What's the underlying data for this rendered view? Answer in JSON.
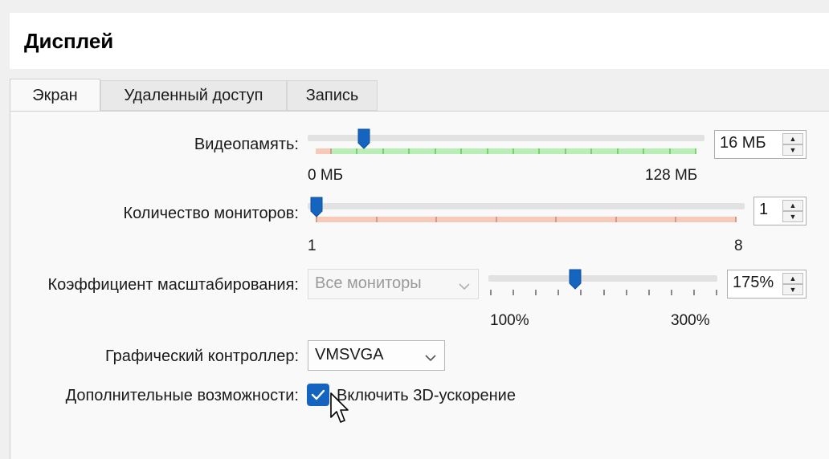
{
  "header": {
    "title": "Дисплей"
  },
  "tabs": [
    {
      "label": "Экран",
      "active": true
    },
    {
      "label": "Удаленный доступ",
      "active": false
    },
    {
      "label": "Запись",
      "active": false
    }
  ],
  "video_memory": {
    "label": "Видеопамять:",
    "value": "16 МБ",
    "min_label": "0 МБ",
    "max_label": "128 МБ",
    "fraction": 0.125
  },
  "monitors": {
    "label": "Количество мониторов:",
    "value": "1",
    "min_label": "1",
    "max_label": "8",
    "fraction": 0.0
  },
  "scale": {
    "label": "Коэффициент масштабирования:",
    "monitor_select": "Все мониторы",
    "value": "175%",
    "min_label": "100%",
    "max_label": "300%",
    "fraction": 0.375
  },
  "graphics_controller": {
    "label": "Графический контроллер:",
    "value": "VMSVGA"
  },
  "extended_features": {
    "label": "Дополнительные возможности:",
    "checkbox_label": "Включить 3D-ускорение",
    "checked": true
  },
  "colors": {
    "accent": "#1565c0",
    "good_bar": "#b9efb6",
    "good_tick": "#7ccf74",
    "warn_bar": "#f6c9b9",
    "warn_tick": "#d8998a"
  }
}
